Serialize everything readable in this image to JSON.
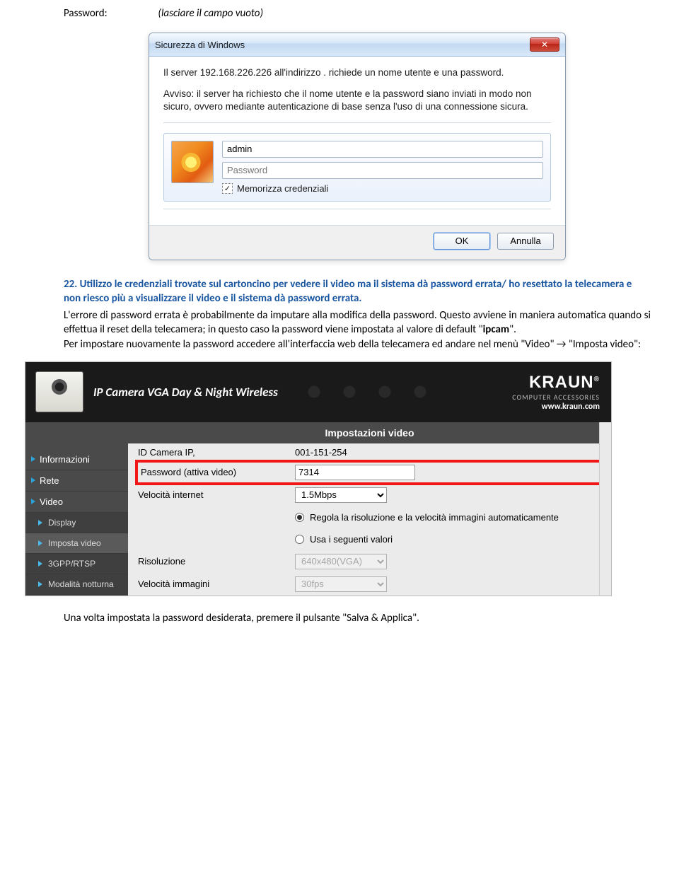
{
  "top": {
    "label": "Password:",
    "value": "(lasciare il campo vuoto)"
  },
  "windialog": {
    "title": "Sicurezza di Windows",
    "msg1": "Il server 192.168.226.226 all'indirizzo . richiede un nome utente e una password.",
    "msg2": "Avviso: il server ha richiesto che il nome utente e la password siano inviati in modo non sicuro, ovvero mediante autenticazione di base senza l'uso di una connessione sicura.",
    "username_value": "admin",
    "password_placeholder": "Password",
    "remember_label": "Memorizza credenziali",
    "remember_checked": true,
    "ok": "OK",
    "cancel": "Annulla"
  },
  "qa": {
    "num": "22.",
    "question": "Utilizzo le credenziali trovate sul cartoncino per vedere il video ma il sistema dà password errata/ ho resettato la telecamera e non riesco più a visualizzare il video e il sistema dà password errata.",
    "answer_p1": "L'errore di password errata è probabilmente da imputare alla modifica della password. Questo avviene in maniera automatica quando si effettua il reset della telecamera; in questo caso la password viene impostata al valore di default \"",
    "answer_bold": "ipcam",
    "answer_p1b": "\".",
    "answer_p2": "Per impostare nuovamente la password accedere all'interfaccia web della telecamera ed andare nel menù \"Video\" → \"Imposta video\":"
  },
  "camui": {
    "header_title": "IP Camera VGA Day & Night Wireless",
    "brand": "KRAUN",
    "brand_sub": "COMPUTER ACCESSORIES",
    "brand_url": "www.kraun.com",
    "section_title": "Impostazioni video",
    "sidebar": [
      {
        "label": "Informazioni",
        "sub": false
      },
      {
        "label": "Rete",
        "sub": false
      },
      {
        "label": "Video",
        "sub": false
      },
      {
        "label": "Display",
        "sub": true
      },
      {
        "label": "Imposta video",
        "sub": true,
        "active": true
      },
      {
        "label": "3GPP/RTSP",
        "sub": true
      },
      {
        "label": "Modalità notturna",
        "sub": true
      }
    ],
    "rows": {
      "id_label": "ID Camera IP,",
      "id_value": "001-151-254",
      "pwd_label": "Password (attiva video)",
      "pwd_value": "7314",
      "speed_label": "Velocità internet",
      "speed_value": "1.5Mbps",
      "opt1": "Regola la risoluzione e la velocità immagini automaticamente",
      "opt2": "Usa i seguenti valori",
      "res_label": "Risoluzione",
      "res_value": "640x480(VGA)",
      "fps_label": "Velocità immagini",
      "fps_value": "30fps"
    }
  },
  "footer": "Una volta impostata la password desiderata, premere il pulsante \"Salva & Applica\"."
}
